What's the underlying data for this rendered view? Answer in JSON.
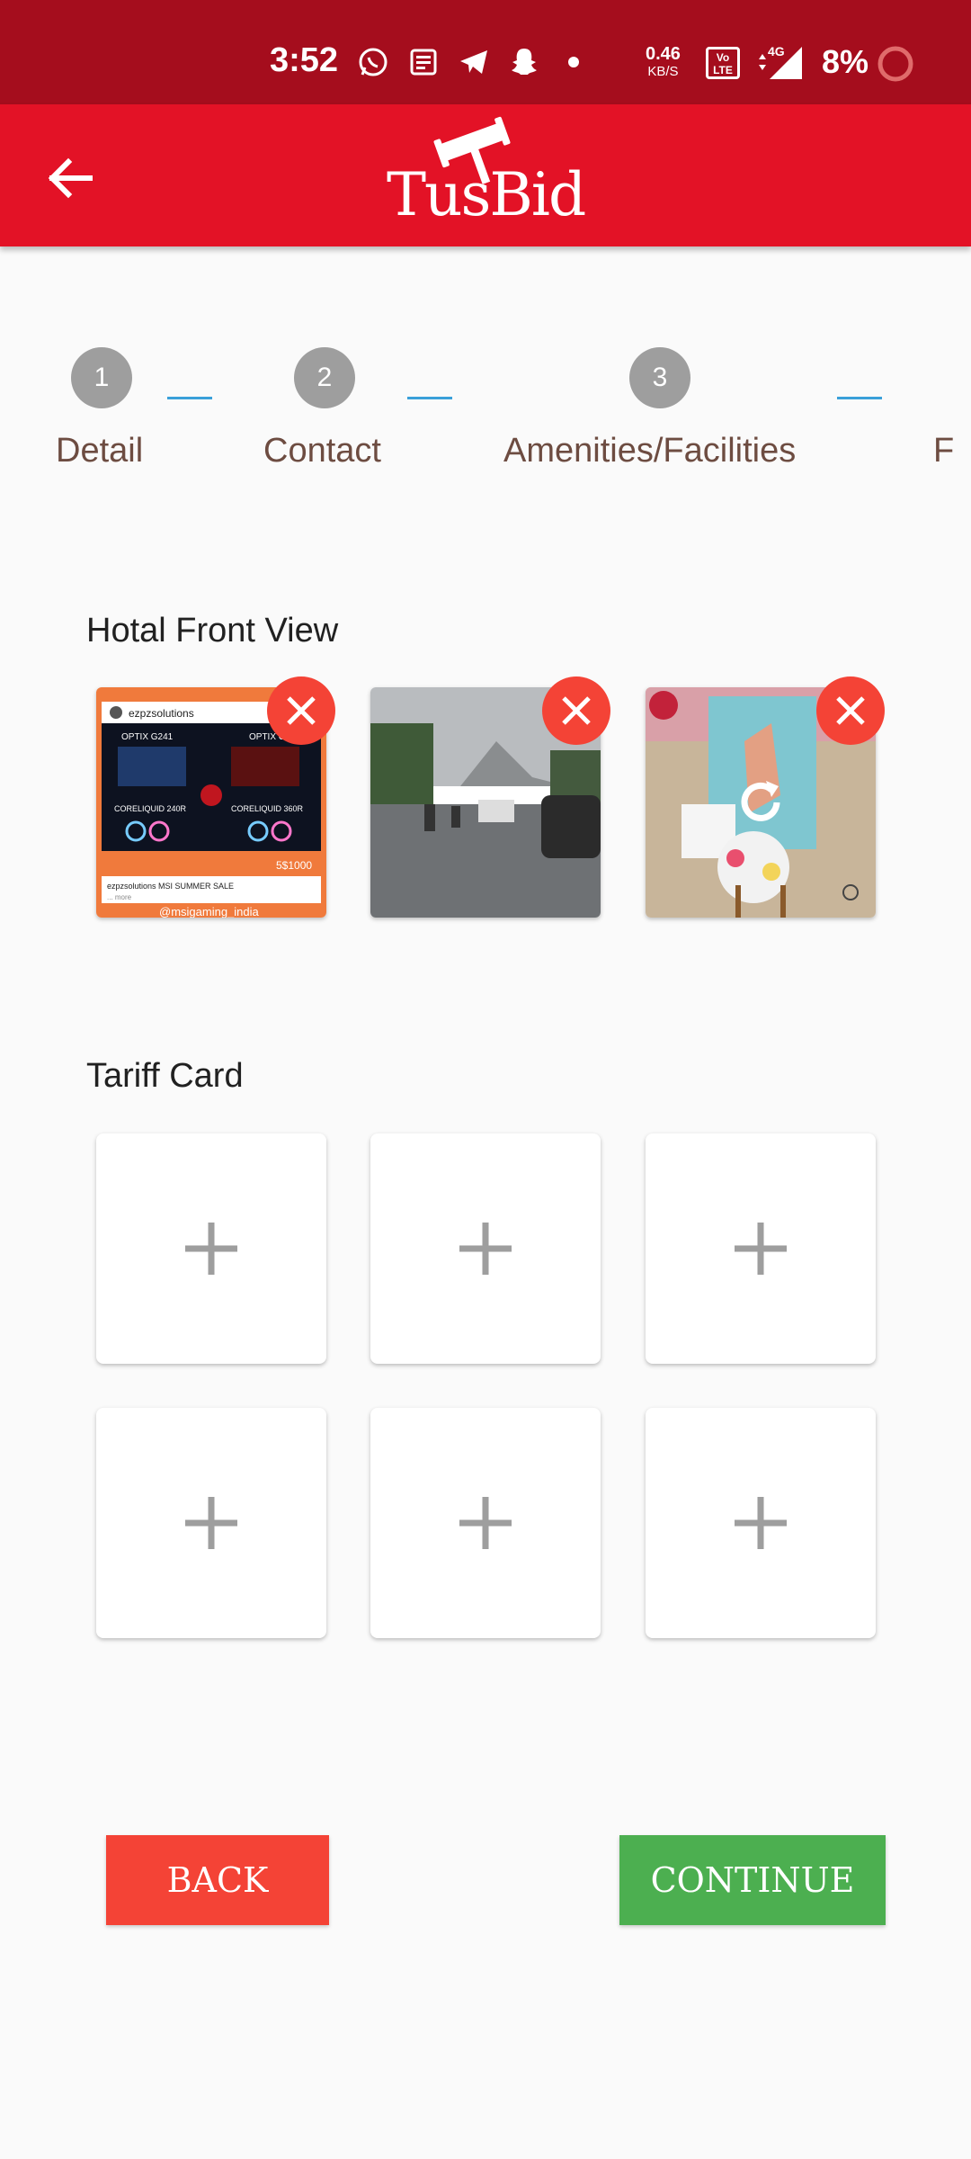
{
  "status_bar": {
    "time": "3:52",
    "net_speed_value": "0.46",
    "net_speed_unit": "KB/S",
    "volte_label": "Vo LTE",
    "network_type": "4G",
    "battery_percent": "8%",
    "icons": [
      "whatsapp-icon",
      "news-icon",
      "telegram-icon",
      "snapchat-icon",
      "dot-icon",
      "volte-icon",
      "signal-icon",
      "battery-icon"
    ]
  },
  "app_bar": {
    "logo_text": "TusBid",
    "back_icon": "arrow-left-icon"
  },
  "stepper": {
    "steps": [
      {
        "number": "1",
        "label": "Detail"
      },
      {
        "number": "2",
        "label": "Contact"
      },
      {
        "number": "3",
        "label": "Amenities/Facilities"
      },
      {
        "number": "",
        "label": "F"
      }
    ]
  },
  "front_view": {
    "title": "Hotal Front View",
    "images": [
      {
        "caption_top": "ezpzsolutions",
        "left_label": "OPTIX G241",
        "right_label": "OPTIX G2",
        "bottom_left": "CORELIQUID 240R",
        "bottom_right": "CORELIQUID 360R",
        "price": "5$1000",
        "footer": "ezpzsolutions MSI SUMMER SALE",
        "more": "... more",
        "handle": "@msigaming_india"
      },
      {
        "description": "street"
      },
      {
        "description": "decor",
        "overlay_icon": "refresh-icon"
      }
    ]
  },
  "tariff_card": {
    "title": "Tariff Card",
    "slots": 6,
    "add_icon": "plus-icon"
  },
  "actions": {
    "back_label": "BACK",
    "continue_label": "CONTINUE"
  },
  "colors": {
    "status_bar": "#a50d1d",
    "app_bar": "#e31226",
    "step_circle": "#9e9e9e",
    "step_label": "#6d4c41",
    "connector": "#3aa0d9",
    "remove": "#f44336",
    "back_button": "#f44336",
    "continue_button": "#4caf50"
  }
}
